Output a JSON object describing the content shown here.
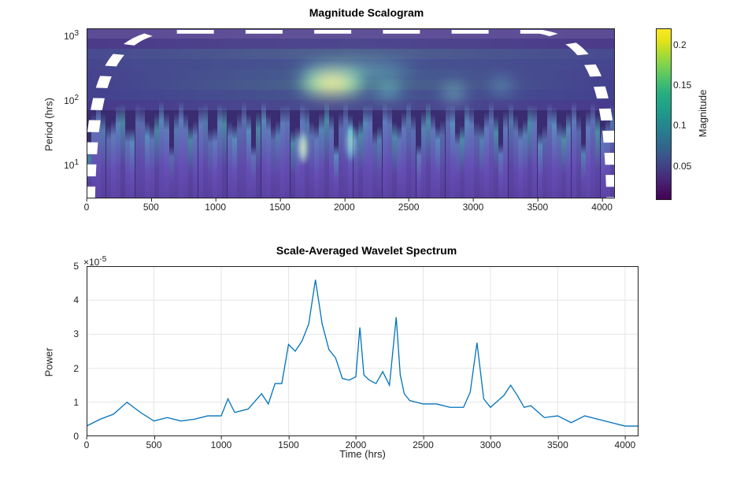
{
  "top": {
    "title": "Magnitude Scalogram",
    "ylabel": "Period (hrs)",
    "yticks": [
      "10^1",
      "10^2",
      "10^3"
    ],
    "xticks": [
      "0",
      "500",
      "1000",
      "1500",
      "2000",
      "2500",
      "3000",
      "3500",
      "4000"
    ],
    "colorbar_label": "Magnitude",
    "colorbar_ticks": [
      "0.05",
      "0.1",
      "0.15",
      "0.2"
    ]
  },
  "bottom": {
    "title": "Scale-Averaged Wavelet Spectrum",
    "ylabel": "Power",
    "xlabel": "Time (hrs)",
    "exp": "×10^{-5}",
    "yticks": [
      "0",
      "1",
      "2",
      "3",
      "4",
      "5"
    ],
    "xticks": [
      "0",
      "500",
      "1000",
      "1500",
      "2000",
      "2500",
      "3000",
      "3500",
      "4000"
    ]
  },
  "chart_data": [
    {
      "type": "heatmap",
      "title": "Magnitude Scalogram",
      "xlabel": "Time (hrs)",
      "ylabel": "Period (hrs)",
      "xlim": [
        0,
        4100
      ],
      "y_scale": "log",
      "ylim": [
        3,
        1300
      ],
      "z_label": "Magnitude",
      "zlim": [
        0.01,
        0.22
      ],
      "peak_region": {
        "time": [
          1550,
          1850
        ],
        "period": [
          60,
          180
        ],
        "magnitude": 0.22
      },
      "secondary_peaks": [
        {
          "time": 2300,
          "period": 120,
          "magnitude": 0.14
        },
        {
          "time": 2900,
          "period": 90,
          "magnitude": 0.13
        },
        {
          "time": 3200,
          "period": 130,
          "magnitude": 0.1
        }
      ],
      "cone_of_influence": "present (white dashed arch)"
    },
    {
      "type": "line",
      "title": "Scale-Averaged Wavelet Spectrum",
      "xlabel": "Time (hrs)",
      "ylabel": "Power",
      "xlim": [
        0,
        4100
      ],
      "ylim": [
        0,
        5e-05
      ],
      "y_multiplier": 1e-05,
      "x": [
        0,
        100,
        200,
        300,
        400,
        500,
        600,
        700,
        800,
        900,
        1000,
        1050,
        1100,
        1200,
        1300,
        1350,
        1400,
        1450,
        1500,
        1550,
        1600,
        1650,
        1700,
        1750,
        1800,
        1850,
        1900,
        1950,
        2000,
        2030,
        2060,
        2100,
        2150,
        2200,
        2250,
        2300,
        2330,
        2360,
        2400,
        2500,
        2600,
        2700,
        2800,
        2850,
        2900,
        2950,
        3000,
        3100,
        3150,
        3200,
        3250,
        3300,
        3400,
        3500,
        3600,
        3700,
        3800,
        3900,
        4000,
        4100
      ],
      "values": [
        0.3,
        0.5,
        0.65,
        1.0,
        0.7,
        0.45,
        0.55,
        0.45,
        0.5,
        0.6,
        0.6,
        1.1,
        0.7,
        0.8,
        1.25,
        0.95,
        1.55,
        1.55,
        2.7,
        2.5,
        2.8,
        3.3,
        4.6,
        3.3,
        2.55,
        2.3,
        1.7,
        1.65,
        1.75,
        3.2,
        1.8,
        1.65,
        1.55,
        1.9,
        1.5,
        3.5,
        1.8,
        1.25,
        1.05,
        0.95,
        0.95,
        0.85,
        0.85,
        1.3,
        2.75,
        1.1,
        0.85,
        1.2,
        1.5,
        1.2,
        0.85,
        0.9,
        0.55,
        0.6,
        0.4,
        0.6,
        0.5,
        0.4,
        0.3,
        0.3
      ]
    }
  ]
}
